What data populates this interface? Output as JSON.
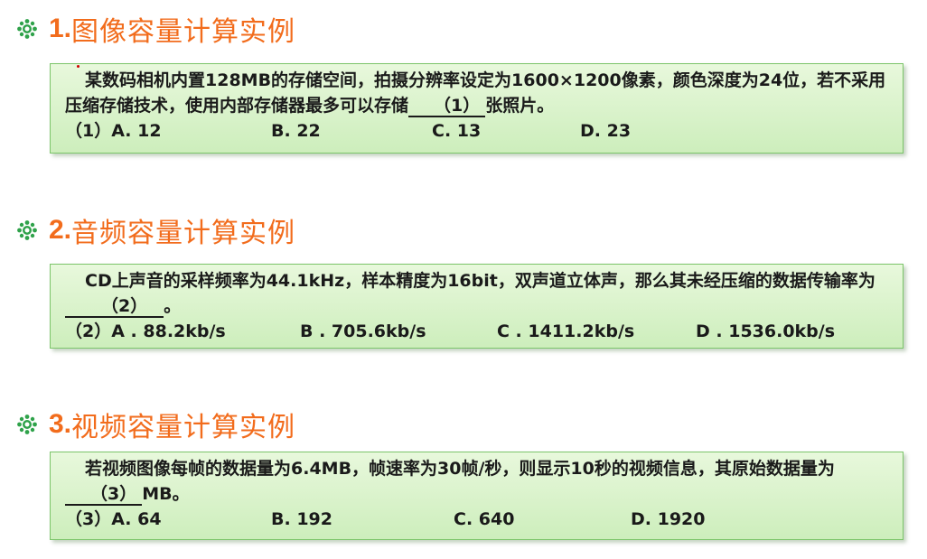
{
  "colors": {
    "heading": "#f26c1c",
    "box_bg": "#d8f2c8",
    "box_border": "#7cc56a",
    "bullet": "#2fa24a"
  },
  "sections": [
    {
      "number": "1.",
      "title": "图像容量计算实例",
      "text_before": "某数码相机内置128MB的存储空间，拍摄分辨率设定为1600×1200像素，颜色深度为24位，若不采用压缩存储技术，使用内部存储器最多可以存储",
      "blank": "（1）",
      "text_after": "张照片。",
      "options": [
        "（1）A. 12",
        "B. 22",
        "C. 13",
        "D. 23"
      ]
    },
    {
      "number": "2.",
      "title": "音频容量计算实例",
      "text_before": "CD上声音的采样频率为44.1kHz，样本精度为16bit，双声道立体声，那么其未经压缩的数据传输率为",
      "blank": "（2）",
      "text_after": "。",
      "options": [
        "（2）A . 88.2kb/s",
        "B . 705.6kb/s",
        "C . 1411.2kb/s",
        "D . 1536.0kb/s"
      ]
    },
    {
      "number": "3.",
      "title": "视频容量计算实例",
      "text_before": "若视频图像每帧的数据量为6.4MB，帧速率为30帧/秒，则显示10秒的视频信息，其原始数据量为",
      "blank": "（3）",
      "text_after": "MB。",
      "options": [
        "（3）A. 64",
        "B. 192",
        "C. 640",
        "D. 1920"
      ]
    }
  ]
}
